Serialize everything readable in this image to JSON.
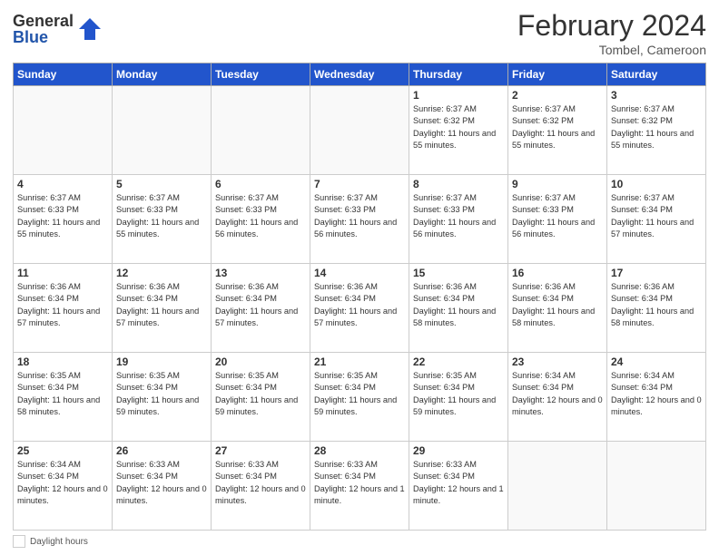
{
  "header": {
    "logo_general": "General",
    "logo_blue": "Blue",
    "title": "February 2024",
    "subtitle": "Tombel, Cameroon"
  },
  "days_of_week": [
    "Sunday",
    "Monday",
    "Tuesday",
    "Wednesday",
    "Thursday",
    "Friday",
    "Saturday"
  ],
  "weeks": [
    [
      {
        "day": "",
        "empty": true
      },
      {
        "day": "",
        "empty": true
      },
      {
        "day": "",
        "empty": true
      },
      {
        "day": "",
        "empty": true
      },
      {
        "day": "1",
        "sunrise": "6:37 AM",
        "sunset": "6:32 PM",
        "daylight": "11 hours and 55 minutes."
      },
      {
        "day": "2",
        "sunrise": "6:37 AM",
        "sunset": "6:32 PM",
        "daylight": "11 hours and 55 minutes."
      },
      {
        "day": "3",
        "sunrise": "6:37 AM",
        "sunset": "6:32 PM",
        "daylight": "11 hours and 55 minutes."
      }
    ],
    [
      {
        "day": "4",
        "sunrise": "6:37 AM",
        "sunset": "6:33 PM",
        "daylight": "11 hours and 55 minutes."
      },
      {
        "day": "5",
        "sunrise": "6:37 AM",
        "sunset": "6:33 PM",
        "daylight": "11 hours and 55 minutes."
      },
      {
        "day": "6",
        "sunrise": "6:37 AM",
        "sunset": "6:33 PM",
        "daylight": "11 hours and 56 minutes."
      },
      {
        "day": "7",
        "sunrise": "6:37 AM",
        "sunset": "6:33 PM",
        "daylight": "11 hours and 56 minutes."
      },
      {
        "day": "8",
        "sunrise": "6:37 AM",
        "sunset": "6:33 PM",
        "daylight": "11 hours and 56 minutes."
      },
      {
        "day": "9",
        "sunrise": "6:37 AM",
        "sunset": "6:33 PM",
        "daylight": "11 hours and 56 minutes."
      },
      {
        "day": "10",
        "sunrise": "6:37 AM",
        "sunset": "6:34 PM",
        "daylight": "11 hours and 57 minutes."
      }
    ],
    [
      {
        "day": "11",
        "sunrise": "6:36 AM",
        "sunset": "6:34 PM",
        "daylight": "11 hours and 57 minutes."
      },
      {
        "day": "12",
        "sunrise": "6:36 AM",
        "sunset": "6:34 PM",
        "daylight": "11 hours and 57 minutes."
      },
      {
        "day": "13",
        "sunrise": "6:36 AM",
        "sunset": "6:34 PM",
        "daylight": "11 hours and 57 minutes."
      },
      {
        "day": "14",
        "sunrise": "6:36 AM",
        "sunset": "6:34 PM",
        "daylight": "11 hours and 57 minutes."
      },
      {
        "day": "15",
        "sunrise": "6:36 AM",
        "sunset": "6:34 PM",
        "daylight": "11 hours and 58 minutes."
      },
      {
        "day": "16",
        "sunrise": "6:36 AM",
        "sunset": "6:34 PM",
        "daylight": "11 hours and 58 minutes."
      },
      {
        "day": "17",
        "sunrise": "6:36 AM",
        "sunset": "6:34 PM",
        "daylight": "11 hours and 58 minutes."
      }
    ],
    [
      {
        "day": "18",
        "sunrise": "6:35 AM",
        "sunset": "6:34 PM",
        "daylight": "11 hours and 58 minutes."
      },
      {
        "day": "19",
        "sunrise": "6:35 AM",
        "sunset": "6:34 PM",
        "daylight": "11 hours and 59 minutes."
      },
      {
        "day": "20",
        "sunrise": "6:35 AM",
        "sunset": "6:34 PM",
        "daylight": "11 hours and 59 minutes."
      },
      {
        "day": "21",
        "sunrise": "6:35 AM",
        "sunset": "6:34 PM",
        "daylight": "11 hours and 59 minutes."
      },
      {
        "day": "22",
        "sunrise": "6:35 AM",
        "sunset": "6:34 PM",
        "daylight": "11 hours and 59 minutes."
      },
      {
        "day": "23",
        "sunrise": "6:34 AM",
        "sunset": "6:34 PM",
        "daylight": "12 hours and 0 minutes."
      },
      {
        "day": "24",
        "sunrise": "6:34 AM",
        "sunset": "6:34 PM",
        "daylight": "12 hours and 0 minutes."
      }
    ],
    [
      {
        "day": "25",
        "sunrise": "6:34 AM",
        "sunset": "6:34 PM",
        "daylight": "12 hours and 0 minutes."
      },
      {
        "day": "26",
        "sunrise": "6:33 AM",
        "sunset": "6:34 PM",
        "daylight": "12 hours and 0 minutes."
      },
      {
        "day": "27",
        "sunrise": "6:33 AM",
        "sunset": "6:34 PM",
        "daylight": "12 hours and 0 minutes."
      },
      {
        "day": "28",
        "sunrise": "6:33 AM",
        "sunset": "6:34 PM",
        "daylight": "12 hours and 1 minute."
      },
      {
        "day": "29",
        "sunrise": "6:33 AM",
        "sunset": "6:34 PM",
        "daylight": "12 hours and 1 minute."
      },
      {
        "day": "",
        "empty": true
      },
      {
        "day": "",
        "empty": true
      }
    ]
  ],
  "footer": {
    "label": "Daylight hours"
  }
}
